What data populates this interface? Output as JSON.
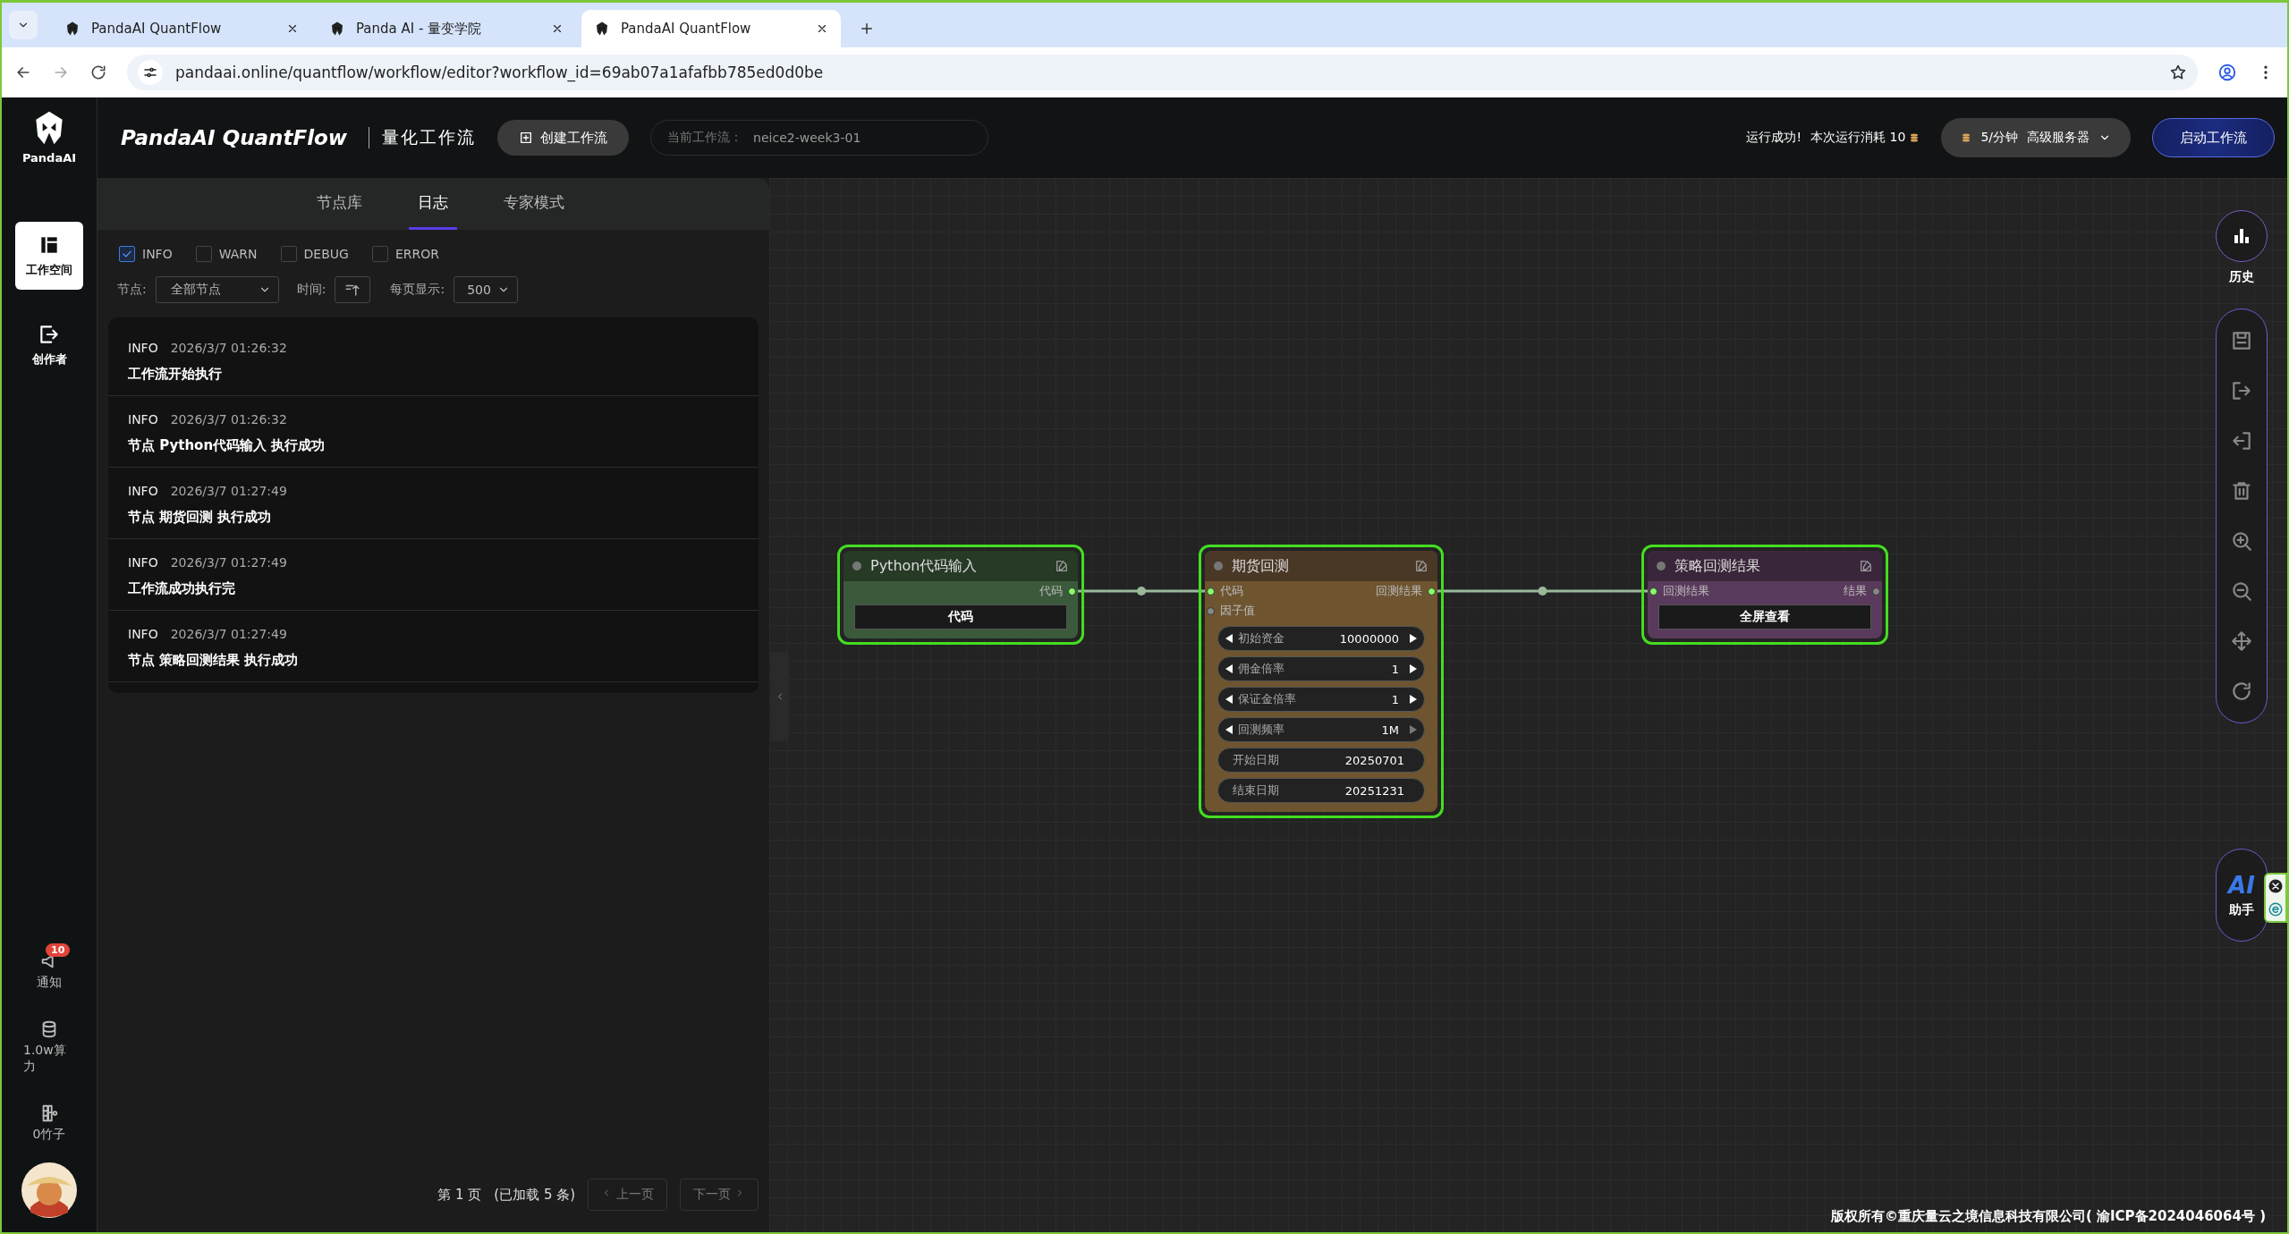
{
  "browser": {
    "tabs": [
      {
        "title": "PandaAI QuantFlow",
        "selected": false
      },
      {
        "title": "Panda AI - 量变学院",
        "selected": false
      },
      {
        "title": "PandaAI QuantFlow",
        "selected": true
      }
    ],
    "url": "pandaai.online/quantflow/workflow/editor?workflow_id=69ab07a1afafbb785ed0d0be"
  },
  "rail": {
    "logo": "PandaAI",
    "items": [
      {
        "kind": "workspace",
        "label": "工作空间",
        "selected": true
      },
      {
        "kind": "creator",
        "label": "创作者",
        "selected": false
      }
    ],
    "bottom": [
      {
        "kind": "notice",
        "label": "通知",
        "badge": "10"
      },
      {
        "kind": "coins",
        "label": "1.0w算力"
      },
      {
        "kind": "bamboo",
        "label": "0竹子"
      }
    ]
  },
  "header": {
    "title": "PandaAI QuantFlow",
    "subtitle": "量化工作流",
    "create_button": "创建工作流",
    "current_workflow": {
      "label": "当前工作流：",
      "value": "neice2-week3-01"
    },
    "run_status": "运行成功!",
    "run_cost": "本次运行消耗 10",
    "server": {
      "rate": "5/分钟",
      "name": "高级服务器"
    },
    "start_button": "启动工作流"
  },
  "panel": {
    "tabs": [
      {
        "label": "节点库",
        "selected": false
      },
      {
        "label": "日志",
        "selected": true
      },
      {
        "label": "专家模式",
        "selected": false
      }
    ],
    "levels": [
      {
        "label": "INFO",
        "checked": true
      },
      {
        "label": "WARN",
        "checked": false
      },
      {
        "label": "DEBUG",
        "checked": false
      },
      {
        "label": "ERROR",
        "checked": false
      }
    ],
    "node_filter": {
      "label": "节点:",
      "value": "全部节点"
    },
    "time_sort": {
      "label": "时间:"
    },
    "page_size": {
      "label": "每页显示:",
      "value": "500"
    },
    "logs": [
      {
        "level": "INFO",
        "time": "2026/3/7 01:26:32",
        "message": "工作流开始执行"
      },
      {
        "level": "INFO",
        "time": "2026/3/7 01:26:32",
        "message": "节点 Python代码输入 执行成功"
      },
      {
        "level": "INFO",
        "time": "2026/3/7 01:27:49",
        "message": "节点 期货回测 执行成功"
      },
      {
        "level": "INFO",
        "time": "2026/3/7 01:27:49",
        "message": "工作流成功执行完"
      },
      {
        "level": "INFO",
        "time": "2026/3/7 01:27:49",
        "message": "节点 策略回测结果 执行成功"
      }
    ],
    "pagination": {
      "page": "第 1 页",
      "loaded": "(已加载 5 条)",
      "prev": "上一页",
      "next": "下一页"
    }
  },
  "canvas": {
    "nodes": [
      {
        "kind": "code",
        "title": "Python代码输入",
        "outputs": [
          {
            "label": "代码",
            "connected": true
          }
        ],
        "fields": [
          {
            "kind": "button",
            "label": "代码"
          }
        ]
      },
      {
        "kind": "backtest",
        "title": "期货回测",
        "inputs": [
          {
            "label": "代码",
            "connected": true
          },
          {
            "label": "因子值",
            "connected": false
          }
        ],
        "outputs": [
          {
            "label": "回测结果",
            "connected": true
          }
        ],
        "fields": [
          {
            "kind": "stepper",
            "label": "初始资金",
            "value": "10000000",
            "next_disabled": false
          },
          {
            "kind": "stepper",
            "label": "佣金倍率",
            "value": "1",
            "next_disabled": false
          },
          {
            "kind": "stepper",
            "label": "保证金倍率",
            "value": "1",
            "next_disabled": false
          },
          {
            "kind": "stepper",
            "label": "回测频率",
            "value": "1M",
            "next_disabled": true
          },
          {
            "kind": "text",
            "label": "开始日期",
            "value": "20250701"
          },
          {
            "kind": "text",
            "label": "结束日期",
            "value": "20251231"
          }
        ]
      },
      {
        "kind": "result",
        "title": "策略回测结果",
        "inputs": [
          {
            "label": "回测结果",
            "connected": true
          }
        ],
        "outputs": [
          {
            "label": "结果",
            "connected": false
          }
        ],
        "fields": [
          {
            "kind": "button",
            "label": "全屏查看"
          }
        ]
      }
    ],
    "toolbar": {
      "history": "历史",
      "assistant_logo": "AI",
      "assistant": "助手"
    },
    "footer": "版权所有©重庆量云之境信息科技有限公司( 渝ICP备2024046064号 )"
  }
}
